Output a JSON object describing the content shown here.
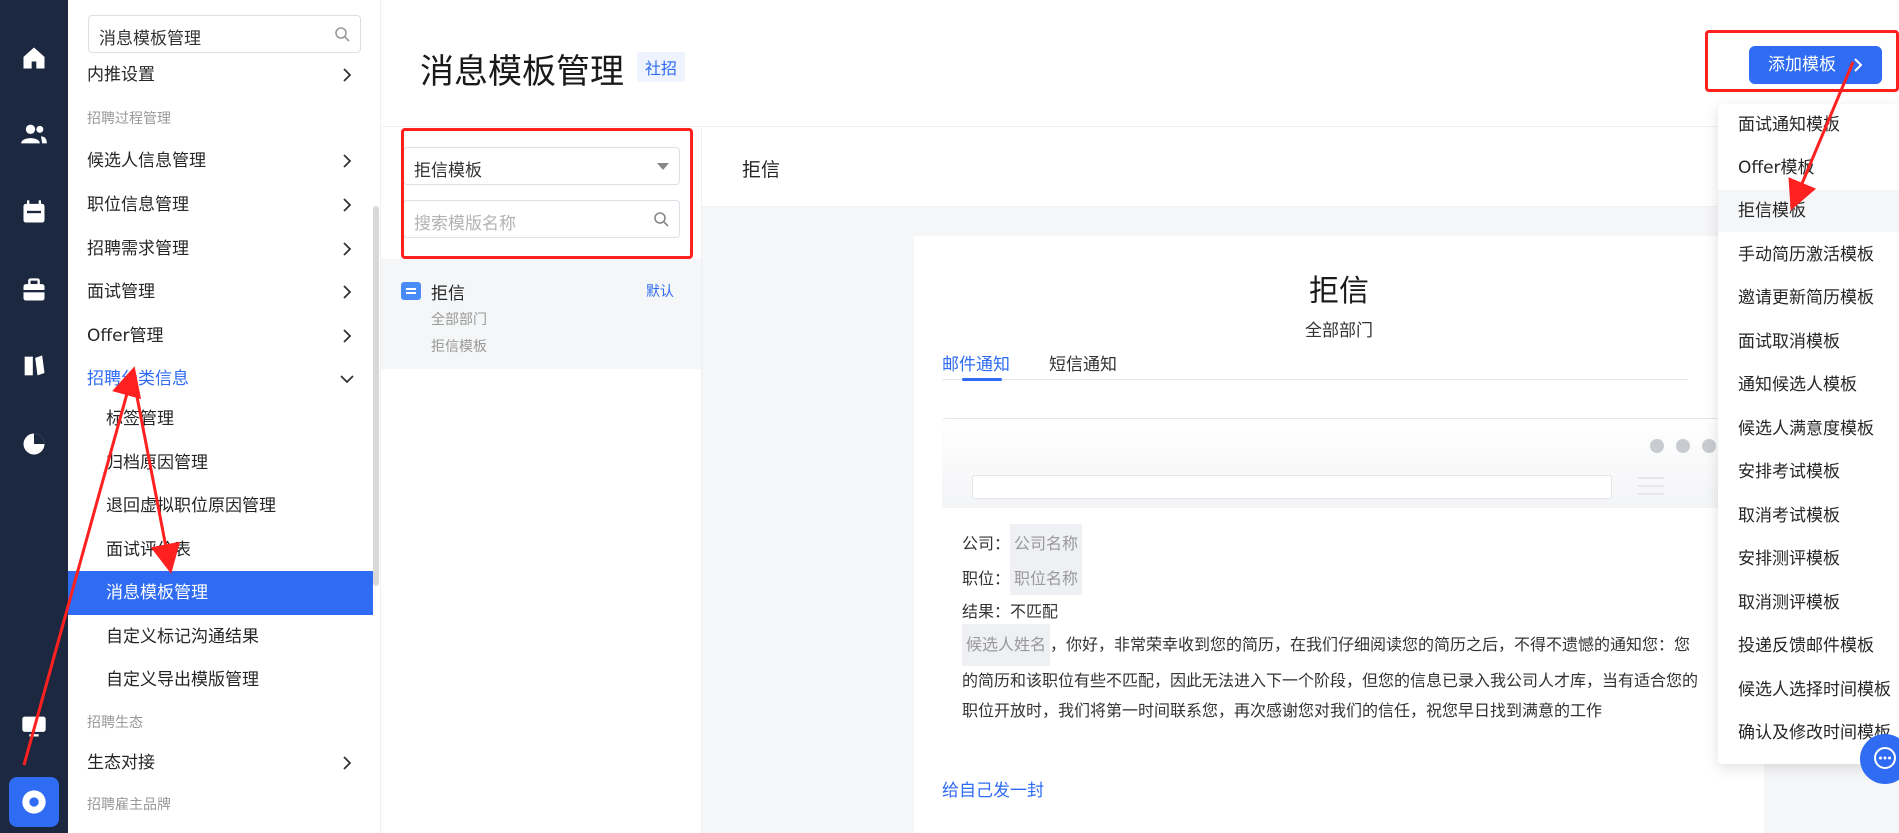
{
  "rail": {
    "icons": [
      "home-icon",
      "users-icon",
      "calendar-icon",
      "briefcase-icon",
      "book-icon",
      "pie-chart-icon",
      "monitor-icon",
      "settings-icon"
    ]
  },
  "sidebar": {
    "search_value": "消息模板管理",
    "items": [
      {
        "label": "内推设置"
      },
      {
        "group": "招聘过程管理"
      },
      {
        "label": "候选人信息管理"
      },
      {
        "label": "职位信息管理"
      },
      {
        "label": "招聘需求管理"
      },
      {
        "label": "面试管理"
      },
      {
        "label": "Offer管理"
      },
      {
        "label": "招聘分类信息"
      },
      {
        "label": "标签管理"
      },
      {
        "label": "归档原因管理"
      },
      {
        "label": "退回虚拟职位原因管理"
      },
      {
        "label": "面试评价表"
      },
      {
        "label": "消息模板管理"
      },
      {
        "label": "自定义标记沟通结果"
      },
      {
        "label": "自定义导出模版管理"
      },
      {
        "group": "招聘生态"
      },
      {
        "label": "生态对接"
      },
      {
        "group": "招聘雇主品牌"
      }
    ]
  },
  "header": {
    "title": "消息模板管理",
    "tag": "社招",
    "add_button": "添加模板"
  },
  "list_panel": {
    "select_value": "拒信模板",
    "search_placeholder": "搜索模版名称",
    "items": [
      {
        "name": "拒信",
        "badge": "默认",
        "dept": "全部部门",
        "type": "拒信模板"
      }
    ]
  },
  "preview": {
    "header_title": "拒信",
    "title": "拒信",
    "dept": "全部部门",
    "tabs": [
      "邮件通知",
      "短信通知"
    ],
    "company_label": "公司：",
    "company_var": "公司名称",
    "position_label": "职位：",
    "position_var": "职位名称",
    "result_label": "结果：",
    "result_value": "不匹配",
    "candidate_var": "候选人姓名",
    "body_text": "，你好，非常荣幸收到您的简历，在我们仔细阅读您的简历之后，不得不遗憾的通知您：您的简历和该职位有些不匹配，因此无法进入下一个阶段，但您的信息已录入我公司人才库，当有适合您的职位开放时，我们将第一时间联系您，再次感谢您对我们的信任，祝您早日找到满意的工作",
    "send_self": "给自己发一封"
  },
  "dropdown": {
    "items": [
      "面试通知模板",
      "Offer模板",
      "拒信模板",
      "手动简历激活模板",
      "邀请更新简历模板",
      "面试取消模板",
      "通知候选人模板",
      "候选人满意度模板",
      "安排考试模板",
      "取消考试模板",
      "安排测评模板",
      "取消测评模板",
      "投递反馈邮件模板",
      "候选人选择时间模板",
      "确认及修改时间模板"
    ]
  },
  "colors": {
    "accent": "#2f6bf3",
    "rail_bg": "#1c2740",
    "annotation_red": "#ff2020"
  }
}
